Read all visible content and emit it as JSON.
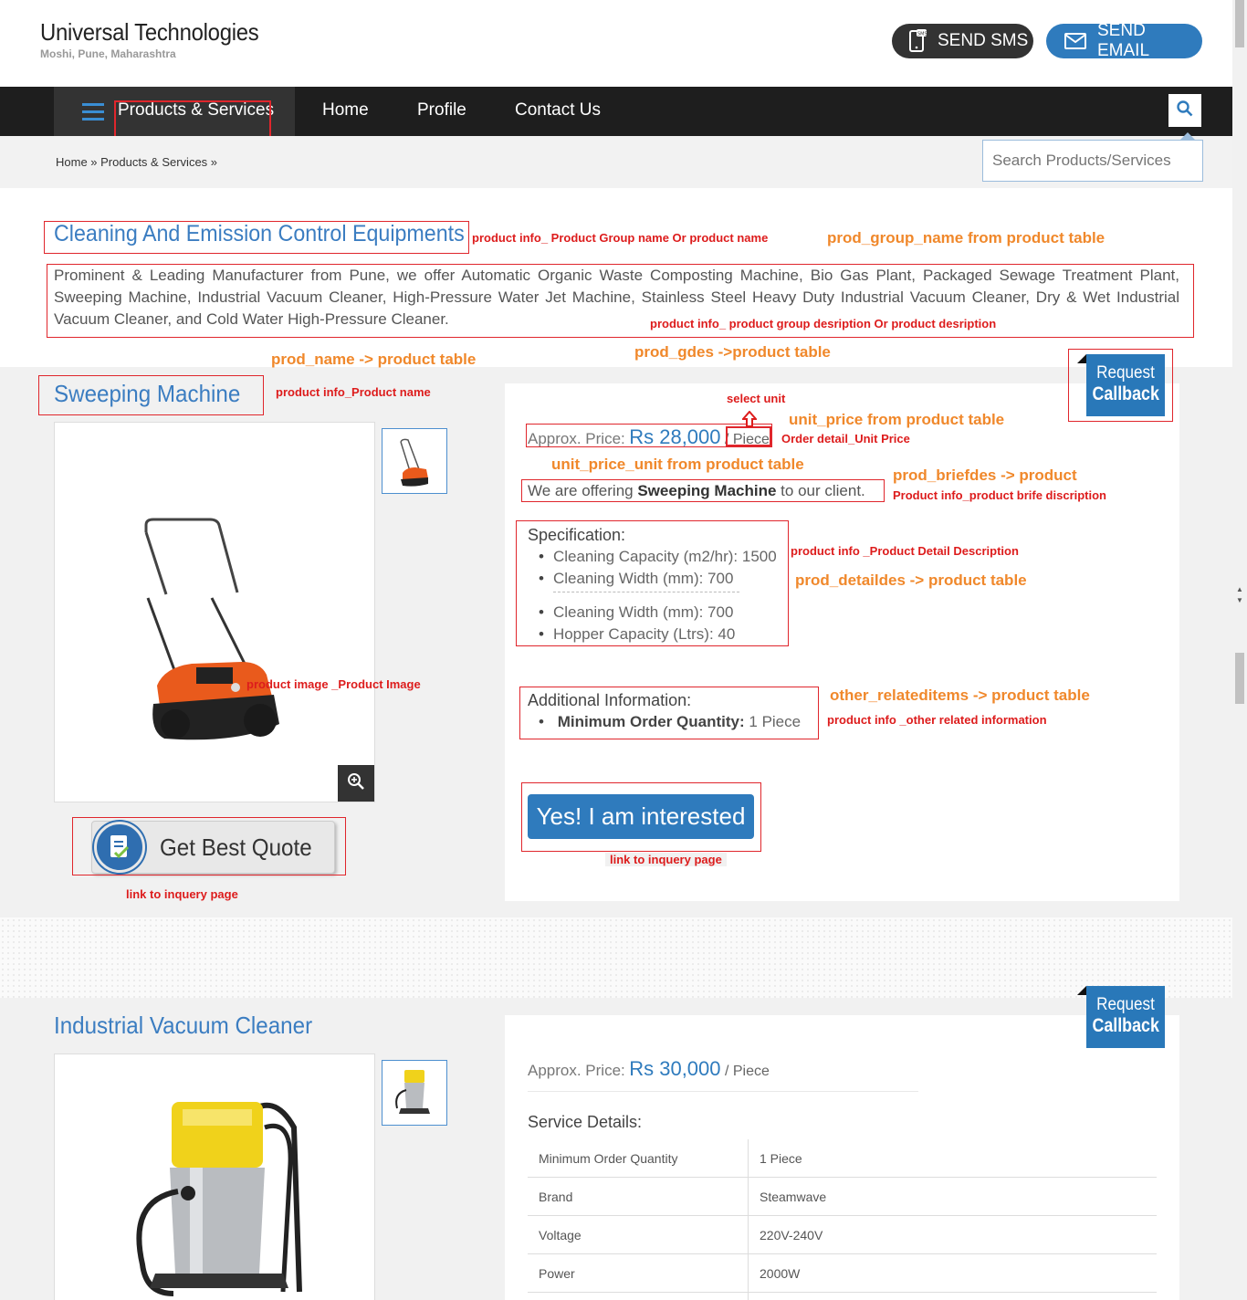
{
  "header": {
    "company_name": "Universal Technologies",
    "location": "Moshi, Pune, Maharashtra",
    "sms_label": "SEND SMS",
    "email_label": "SEND EMAIL"
  },
  "nav": {
    "products": "Products & Services",
    "home": "Home",
    "profile": "Profile",
    "contact": "Contact Us"
  },
  "breadcrumb": "Home » Products & Services »",
  "search": {
    "placeholder": "Search Products/Services"
  },
  "group": {
    "title": "Cleaning And Emission Control Equipments",
    "description": "Prominent & Leading Manufacturer from Pune, we offer Automatic Organic Waste Composting Machine, Bio Gas Plant, Packaged Sewage Treatment Plant, Sweeping Machine, Industrial Vacuum Cleaner, High-Pressure Water Jet Machine, Stainless Steel Heavy Duty Industrial Vacuum Cleaner, Dry & Wet Industrial Vacuum Cleaner, and Cold Water High-Pressure Cleaner."
  },
  "product1": {
    "name": "Sweeping Machine",
    "price_label": "Approx. Price:",
    "price": "Rs 28,000",
    "price_sep": "/",
    "unit": "Piece",
    "brief_pre": "We are offering",
    "brief_bold": "Sweeping Machine",
    "brief_post": "to our client.",
    "spec_heading": "Specification:",
    "specs": [
      "Cleaning Capacity (m2/hr): 1500",
      "Cleaning Width (mm): 700",
      "Cleaning Width (mm): 700",
      "Hopper Capacity (Ltrs): 40"
    ],
    "addl_heading": "Additional Information:",
    "moq_label": "Minimum Order Quantity:",
    "moq_value": "1 Piece",
    "interested_label": "Yes! I am interested",
    "quote_label": "Get Best Quote"
  },
  "product2": {
    "name": "Industrial Vacuum Cleaner",
    "price_label": "Approx. Price:",
    "price": "Rs 30,000",
    "unit": "/ Piece",
    "details_heading": "Service Details:",
    "details": [
      {
        "k": "Minimum Order Quantity",
        "v": "1 Piece"
      },
      {
        "k": "Brand",
        "v": "Steamwave"
      },
      {
        "k": "Voltage",
        "v": "220V-240V"
      },
      {
        "k": "Power",
        "v": "2000W"
      }
    ]
  },
  "callback": {
    "line1": "Request",
    "line2": "Callback"
  },
  "annotations": {
    "group_name_red": "product info_ Product Group name Or product name",
    "group_name_orange": "prod_group_name from product table",
    "group_desc_red": "product info_ product group desription Or product desription",
    "prod_name_orange": "prod_name -> product table",
    "prod_gdes_orange": "prod_gdes ->product table",
    "prod_name_red": "product info_Product name",
    "select_unit": "select unit",
    "unit_price_orange": "unit_price from product table",
    "order_detail_red": "Order detail_Unit Price",
    "unit_price_unit_orange": "unit_price_unit from product table",
    "briefdes_orange": "prod_briefdes -> product",
    "briefdes_red": "Product info_product brife discription",
    "detail_desc_red": "product info _Product Detail Description",
    "detaildes_orange": "prod_detaildes -> product table",
    "image_red": "product image _Product Image",
    "related_orange": "other_relateditems -> product table",
    "related_red": "product info _other related information",
    "inquiry_link_1": "link to inquery page",
    "inquiry_link_2": "link to inquery page"
  }
}
